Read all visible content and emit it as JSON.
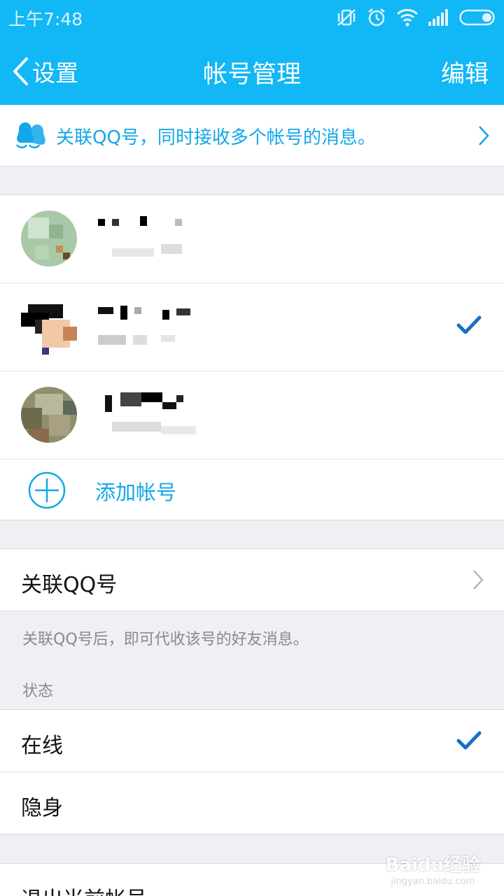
{
  "status_bar": {
    "time": "上午7:48"
  },
  "nav": {
    "back_label": "设置",
    "title": "帐号管理",
    "edit_label": "编辑"
  },
  "banner": {
    "text": "关联QQ号，同时接收多个帐号的消息。"
  },
  "accounts": {
    "items": [
      {
        "selected": false
      },
      {
        "selected": true
      },
      {
        "selected": false
      }
    ],
    "add_label": "添加帐号"
  },
  "link": {
    "label": "关联QQ号",
    "note": "关联QQ号后，即可代收该号的好友消息。"
  },
  "status_section": {
    "header": "状态",
    "options": [
      {
        "label": "在线",
        "selected": true
      },
      {
        "label": "隐身",
        "selected": false
      }
    ]
  },
  "logout": {
    "label": "退出当前帐号"
  },
  "watermark": {
    "text": "Baidu经验",
    "url": "jingyan.baidu.com"
  },
  "colors": {
    "accent": "#12b7f5",
    "link": "#12a7e8",
    "check": "#1a6fc7"
  }
}
